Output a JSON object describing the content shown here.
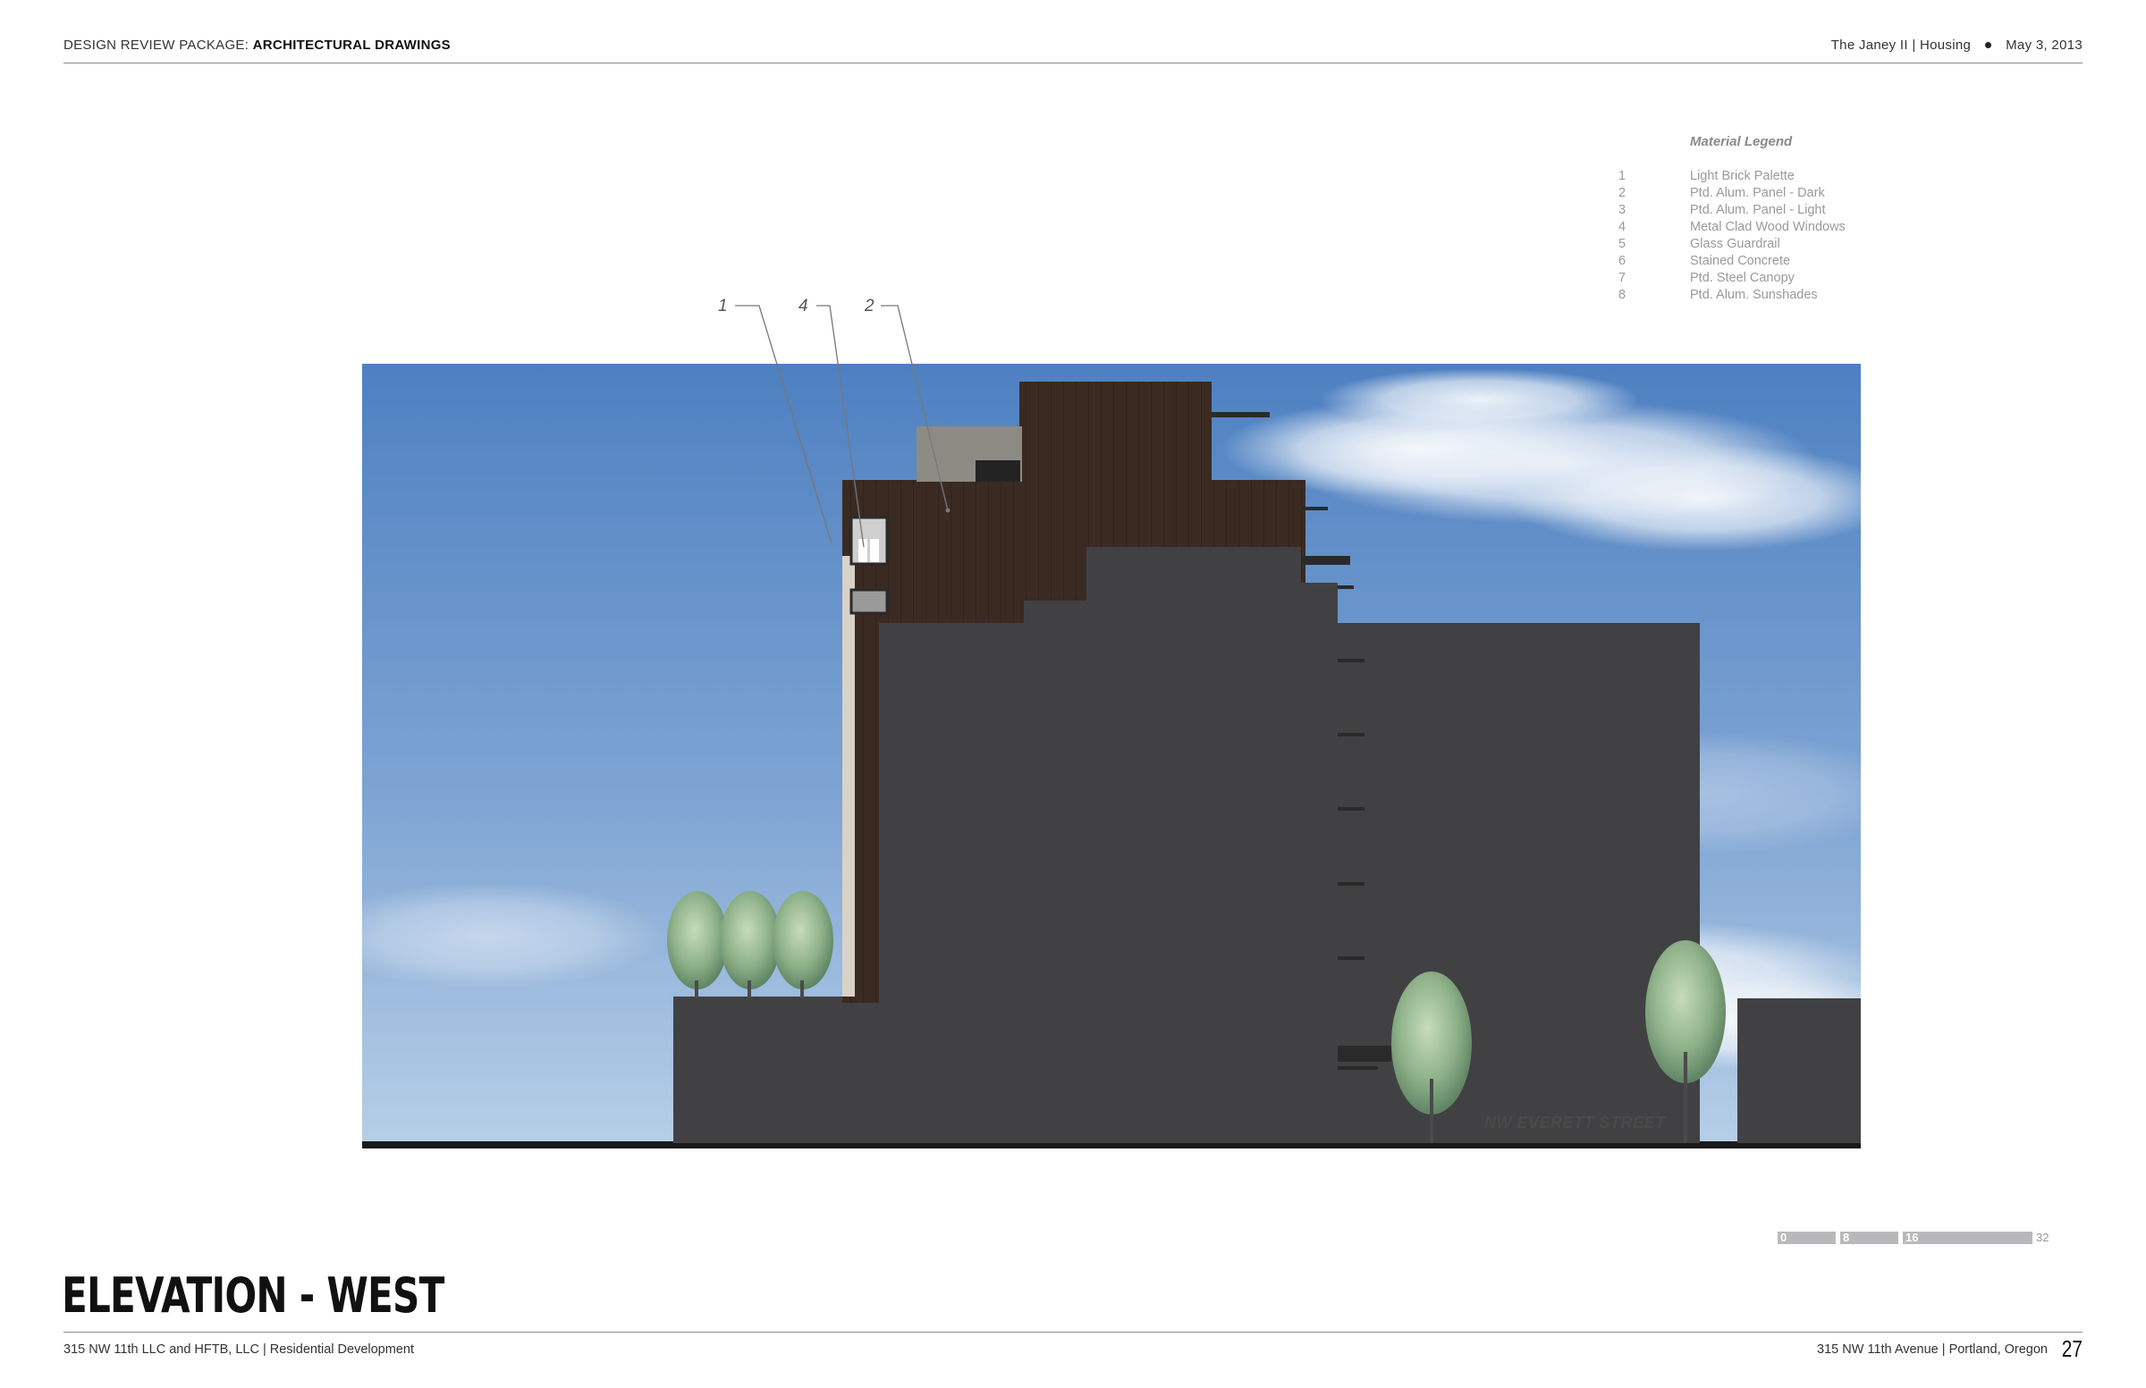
{
  "header": {
    "package_label": "DESIGN REVIEW PACKAGE:",
    "section_label": "ARCHITECTURAL DRAWINGS",
    "project": "The Janey II | Housing",
    "date": "May 3, 2013"
  },
  "legend": {
    "title": "Material Legend",
    "items": [
      {
        "num": "1",
        "label": "Light Brick Palette"
      },
      {
        "num": "2",
        "label": "Ptd. Alum. Panel - Dark"
      },
      {
        "num": "3",
        "label": "Ptd. Alum. Panel - Light"
      },
      {
        "num": "4",
        "label": "Metal Clad Wood Windows"
      },
      {
        "num": "5",
        "label": "Glass Guardrail"
      },
      {
        "num": "6",
        "label": "Stained Concrete"
      },
      {
        "num": "7",
        "label": "Ptd. Steel Canopy"
      },
      {
        "num": "8",
        "label": "Ptd. Alum. Sunshades"
      }
    ]
  },
  "callouts": [
    "1",
    "4",
    "2"
  ],
  "drawing": {
    "street_label": "NW EVERETT STREET"
  },
  "scale": {
    "ticks": [
      "0",
      "8",
      "16",
      "32"
    ]
  },
  "title": "ELEVATION - WEST",
  "footer": {
    "left": "315 NW 11th LLC and HFTB, LLC | Residential Development",
    "right": "315 NW 11th Avenue | Portland, Oregon",
    "page": "27"
  },
  "colors": {
    "sky_top": "#4f81c2",
    "sky_bottom": "#a9c6e3",
    "building_gray": "#414143",
    "cladding_dark": "#3a2a22",
    "brick_light": "#d9d2c7"
  }
}
